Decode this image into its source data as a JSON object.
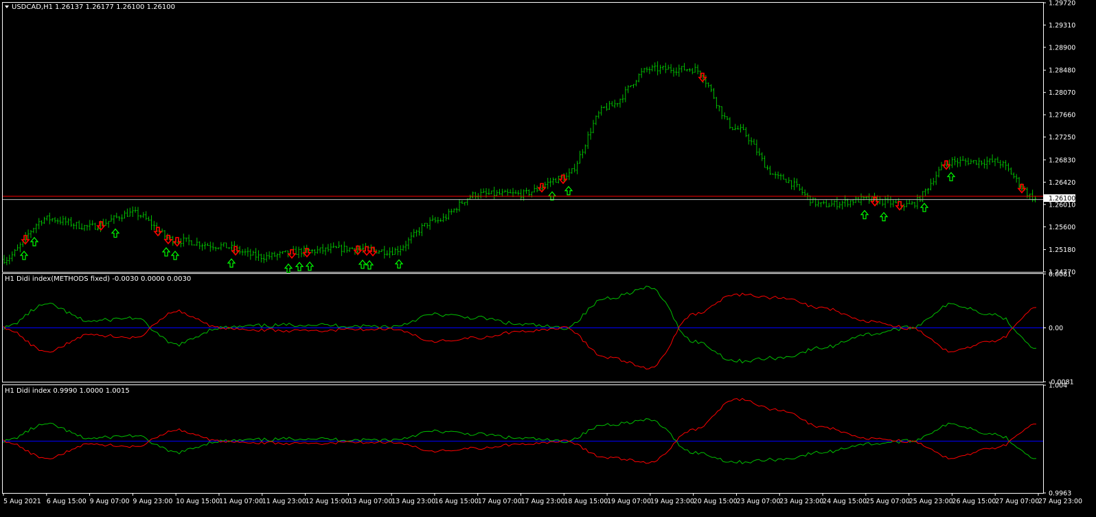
{
  "main": {
    "symbol_label": "USDCAD,H1",
    "ohlc_label": "1.26137 1.26177 1.26100 1.26100",
    "current_price_label": "1.26100",
    "y_ticks": [
      "1.29720",
      "1.29310",
      "1.28900",
      "1.28480",
      "1.28070",
      "1.27660",
      "1.27250",
      "1.26830",
      "1.26420",
      "1.26010",
      "1.25600",
      "1.25180",
      "1.24770"
    ],
    "ylim": [
      1.2477,
      1.2972
    ],
    "current_price": 1.261,
    "red_line_price": 1.2616,
    "colors": {
      "bars": "#00c000",
      "up_arrow": "#00ff00",
      "down_arrow": "#ff0000",
      "current_line": "#c0c0c0",
      "red_line": "#ff0000",
      "axis": "#ffffff"
    }
  },
  "sub1": {
    "title": "H1 Didi index(METHODS fixed) -0.0030 0.0000 0.0030",
    "y_ticks": [
      "0.0081",
      "0.00",
      "-0.0081"
    ],
    "ylim": [
      -0.0081,
      0.0081
    ]
  },
  "sub2": {
    "title": "H1 Didi index 0.9990 1.0000 1.0015",
    "y_ticks": [
      "1.004",
      "0.9963"
    ],
    "ylim": [
      0.9963,
      1.004
    ]
  },
  "x_ticks": [
    "5 Aug 2021",
    "6 Aug 15:00",
    "9 Aug 07:00",
    "9 Aug 23:00",
    "10 Aug 15:00",
    "11 Aug 07:00",
    "11 Aug 23:00",
    "12 Aug 15:00",
    "13 Aug 07:00",
    "13 Aug 23:00",
    "16 Aug 15:00",
    "17 Aug 07:00",
    "17 Aug 23:00",
    "18 Aug 15:00",
    "19 Aug 07:00",
    "19 Aug 23:00",
    "20 Aug 15:00",
    "23 Aug 07:00",
    "23 Aug 23:00",
    "24 Aug 15:00",
    "25 Aug 07:00",
    "25 Aug 23:00",
    "26 Aug 15:00",
    "27 Aug 07:00",
    "27 Aug 23:00"
  ],
  "chart_data": [
    {
      "type": "line",
      "title": "USDCAD,H1",
      "series": [
        {
          "name": "USDCAD close",
          "x": [
            "5 Aug 2021",
            "6 Aug 15:00",
            "9 Aug 07:00",
            "9 Aug 23:00",
            "10 Aug 15:00",
            "11 Aug 07:00",
            "11 Aug 23:00",
            "12 Aug 15:00",
            "13 Aug 07:00",
            "13 Aug 23:00",
            "16 Aug 15:00",
            "17 Aug 07:00",
            "17 Aug 23:00",
            "18 Aug 15:00",
            "19 Aug 07:00",
            "19 Aug 23:00",
            "20 Aug 15:00",
            "23 Aug 07:00",
            "23 Aug 23:00",
            "24 Aug 15:00",
            "25 Aug 07:00",
            "25 Aug 23:00",
            "26 Aug 15:00",
            "27 Aug 07:00",
            "27 Aug 23:00"
          ],
          "values": [
            1.25,
            1.2575,
            1.256,
            1.2585,
            1.2535,
            1.2525,
            1.2505,
            1.2515,
            1.252,
            1.2515,
            1.257,
            1.262,
            1.262,
            1.265,
            1.278,
            1.285,
            1.285,
            1.274,
            1.265,
            1.26,
            1.261,
            1.26,
            1.268,
            1.268,
            1.261
          ]
        }
      ],
      "ylim": [
        1.2477,
        1.2972
      ]
    },
    {
      "type": "line",
      "title": "H1 Didi index(METHODS fixed) -0.0030 0.0000 0.0030",
      "series": [
        {
          "name": "green",
          "values": [
            0.0,
            0.0035,
            0.001,
            0.0015,
            -0.0025,
            0.0,
            0.0003,
            0.0005,
            0.0003,
            0.0002,
            0.002,
            0.0015,
            0.0005,
            0.0,
            0.0045,
            0.006,
            -0.002,
            -0.005,
            -0.0045,
            -0.003,
            -0.001,
            0.0,
            0.0035,
            0.002,
            -0.003
          ]
        },
        {
          "name": "blue",
          "values": [
            0,
            0,
            0,
            0,
            0,
            0,
            0,
            0,
            0,
            0,
            0,
            0,
            0,
            0,
            0,
            0,
            0,
            0,
            0,
            0,
            0,
            0,
            0,
            0,
            0
          ]
        },
        {
          "name": "red",
          "values": [
            0.0,
            -0.0035,
            -0.001,
            -0.0015,
            0.0025,
            0.0,
            -0.0003,
            -0.0005,
            -0.0003,
            -0.0002,
            -0.002,
            -0.0015,
            -0.0005,
            0.0,
            -0.0045,
            -0.006,
            0.002,
            0.005,
            0.0045,
            0.003,
            0.001,
            0.0,
            -0.0035,
            -0.002,
            0.003
          ]
        }
      ],
      "ylim": [
        -0.0081,
        0.0081
      ]
    },
    {
      "type": "line",
      "title": "H1 Didi index 0.9990 1.0000 1.0015",
      "series": [
        {
          "name": "green",
          "values": [
            1.0,
            1.0012,
            1.0002,
            1.0004,
            0.9992,
            1.0,
            1.0001,
            1.0002,
            1.0001,
            1.0001,
            1.0007,
            1.0005,
            1.0002,
            1.0,
            1.0012,
            1.0015,
            0.9992,
            0.9985,
            0.9987,
            0.9992,
            0.9998,
            1.0,
            1.0012,
            1.0005,
            0.9988
          ]
        },
        {
          "name": "blue",
          "values": [
            1,
            1,
            1,
            1,
            1,
            1,
            1,
            1,
            1,
            1,
            1,
            1,
            1,
            1,
            1,
            1,
            1,
            1,
            1,
            1,
            1,
            1,
            1,
            1,
            1
          ]
        },
        {
          "name": "red",
          "values": [
            1.0,
            0.9988,
            0.9998,
            0.9996,
            1.0008,
            1.0,
            0.9999,
            0.9998,
            0.9999,
            0.9999,
            0.9993,
            0.9995,
            0.9998,
            1.0,
            0.9988,
            0.9985,
            1.0008,
            1.003,
            1.0022,
            1.001,
            1.0002,
            1.0,
            0.9988,
            0.9995,
            1.0012
          ]
        }
      ],
      "ylim": [
        0.9963,
        1.004
      ]
    }
  ]
}
